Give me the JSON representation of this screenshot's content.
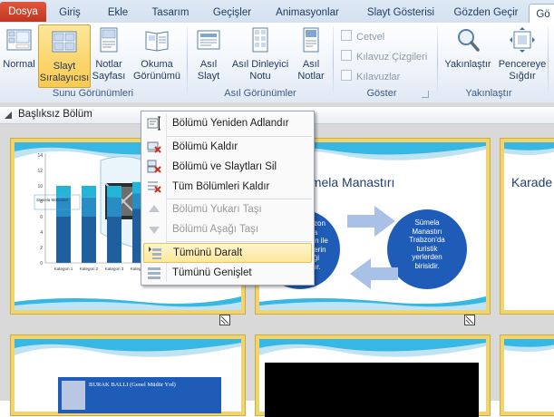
{
  "tabs": [
    "Dosya",
    "Giriş",
    "Ekle",
    "Tasarım",
    "Geçişler",
    "Animasyonlar",
    "Slayt Gösterisi",
    "Gözden Geçir",
    "Gö"
  ],
  "ribbon": {
    "groups": {
      "presentation_views": {
        "label": "Sunu Görünümleri",
        "buttons": [
          "Normal",
          "Slayt Sıralayıcısı",
          "Notlar Sayfası",
          "Okuma Görünümü"
        ],
        "btn_lines": [
          [
            "Normal",
            ""
          ],
          [
            "Slayt",
            "Sıralayıcısı"
          ],
          [
            "Notlar",
            "Sayfası"
          ],
          [
            "Okuma",
            "Görünümü"
          ]
        ]
      },
      "master_views": {
        "label": "Asıl Görünümler",
        "btn_lines": [
          [
            "Asıl",
            "Slayt"
          ],
          [
            "Asıl Dinleyici",
            "Notu"
          ],
          [
            "Asıl",
            "Notlar"
          ]
        ]
      },
      "show": {
        "label": "Göster",
        "checkboxes": [
          "Cetvel",
          "Kılavuz Çizgileri",
          "Kılavuzlar"
        ]
      },
      "zoom": {
        "label": "Yakınlaştır",
        "btn_lines": [
          [
            "Yakınlaştır",
            ""
          ],
          [
            "Pencereye",
            "Sığdır"
          ]
        ]
      }
    }
  },
  "section": {
    "title": "Başlıksız Bölüm"
  },
  "context_menu": {
    "items": [
      {
        "label": "Bölümü Yeniden Adlandır",
        "enabled": true,
        "icon": "rename-icon"
      },
      {
        "label": "Bölümü Kaldır",
        "enabled": true,
        "icon": "remove-section-icon"
      },
      {
        "label": "Bölümü ve Slaytları Sil",
        "enabled": true,
        "icon": "delete-section-icon"
      },
      {
        "label": "Tüm Bölümleri Kaldır",
        "enabled": true,
        "icon": "remove-all-sections-icon"
      },
      {
        "label": "Bölümü Yukarı Taşı",
        "enabled": false,
        "icon": "move-up-icon"
      },
      {
        "label": "Bölümü Aşağı Taşı",
        "enabled": false,
        "icon": "move-down-icon"
      },
      {
        "label": "Tümünü Daralt",
        "enabled": true,
        "highlighted": true,
        "icon": "collapse-all-icon"
      },
      {
        "label": "Tümünü Genişlet",
        "enabled": true,
        "icon": "expand-all-icon"
      }
    ]
  },
  "slides": {
    "s1": {
      "chart_data": {
        "type": "bar",
        "categories": [
          "Kategori 1",
          "Kategori 2",
          "Kategori 3",
          "Kategori 4"
        ],
        "series": [
          {
            "values": [
              6,
              6,
              6,
              7
            ]
          },
          {
            "values": [
              2.5,
              2.5,
              2.5,
              2
            ]
          },
          {
            "values": [
              1.5,
              1.5,
              1.5,
              1.5
            ]
          }
        ],
        "yticks": [
          "14",
          "12",
          "10",
          "8",
          "6",
          "4",
          "2",
          "0"
        ],
        "overlay_text": "Sümela Manastırı"
      }
    },
    "s2": {
      "title": "n Sümela Manastırı",
      "left_circle": [
        "abzon",
        "a",
        "bzon ile",
        "lgilerin",
        "iği",
        "ıtır."
      ],
      "right_circle": [
        "Sümela",
        "Manastırı",
        "Trabzon'da",
        "turistik",
        "yerlerden",
        "birisidir."
      ]
    },
    "s3": {
      "title": "Karade"
    },
    "s5": {
      "name_bar": "BURAK BALLI (Genel Müdür Yrd)"
    }
  },
  "colors": {
    "file_tab": "#c9432c",
    "highlight": "#fde79a",
    "selection": "#f2d46a",
    "circle": "#1f5cb8",
    "arrow": "#a9c1e6",
    "bar1": "#1f5f9e",
    "bar2": "#2a8cc4",
    "bar3": "#22b5d8"
  }
}
